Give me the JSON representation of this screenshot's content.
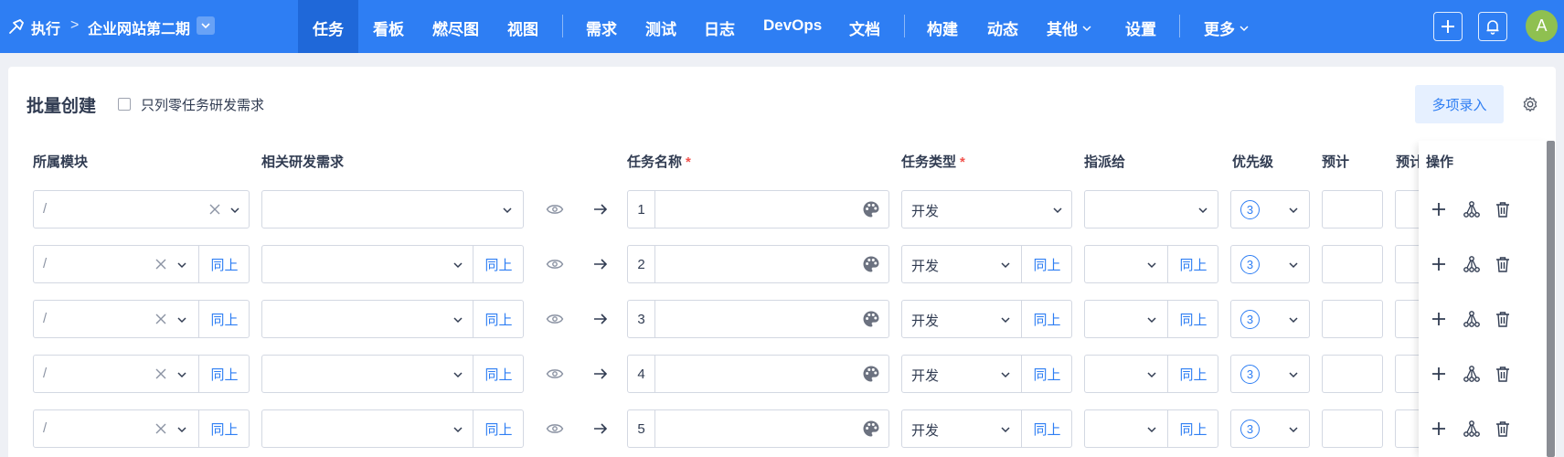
{
  "breadcrumb": {
    "execution": "执行",
    "separator": ">",
    "project": "企业网站第二期"
  },
  "nav": {
    "items": [
      {
        "label": "任务",
        "active": true
      },
      {
        "label": "看板"
      },
      {
        "label": "燃尽图"
      },
      {
        "label": "视图"
      },
      {
        "label": "需求"
      },
      {
        "label": "测试"
      },
      {
        "label": "日志"
      },
      {
        "label": "DevOps"
      },
      {
        "label": "文档"
      },
      {
        "label": "构建"
      },
      {
        "label": "动态"
      },
      {
        "label": "其他",
        "dropdown": true
      },
      {
        "label": "设置"
      },
      {
        "label": "更多",
        "dropdown": true
      }
    ]
  },
  "user": {
    "avatar_initial": "A"
  },
  "page": {
    "title": "批量创建",
    "only_zero_task_label": "只列零任务研发需求",
    "multi_entry_label": "多项录入"
  },
  "columns": {
    "module": "所属模块",
    "story": "相关研发需求",
    "name": "任务名称",
    "name_required": "*",
    "type": "任务类型",
    "type_required": "*",
    "assignee": "指派给",
    "priority": "优先级",
    "estimate": "预计",
    "estimate2": "预计",
    "actions": "操作"
  },
  "same_as_above": "同上",
  "rows": [
    {
      "module": "/",
      "task_no": "1",
      "type": "开发",
      "priority": "3"
    },
    {
      "module": "/",
      "task_no": "2",
      "type": "开发",
      "priority": "3"
    },
    {
      "module": "/",
      "task_no": "3",
      "type": "开发",
      "priority": "3"
    },
    {
      "module": "/",
      "task_no": "4",
      "type": "开发",
      "priority": "3"
    },
    {
      "module": "/",
      "task_no": "5",
      "type": "开发",
      "priority": "3"
    }
  ],
  "colors": {
    "primary": "#2e7ef3",
    "topbar": "#2e7ef3",
    "active_nav": "#1f68d9",
    "required": "#f1524c",
    "avatar": "#8fc050"
  }
}
